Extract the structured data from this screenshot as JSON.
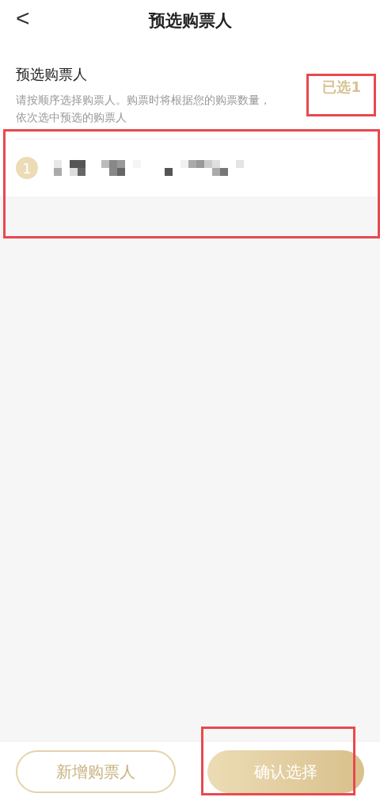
{
  "header": {
    "back": "<",
    "title": "预选购票人"
  },
  "section": {
    "title": "预选购票人",
    "description": "请按顺序选择购票人。购票时将根据您的购票数量，依次选中预选的购票人",
    "count": "已选1"
  },
  "passengers": [
    {
      "number": "1",
      "selected": true
    }
  ],
  "buttons": [
    {
      "label": "新增购票人",
      "kind": "outline"
    },
    {
      "label": "确认选择",
      "kind": "filled"
    }
  ]
}
